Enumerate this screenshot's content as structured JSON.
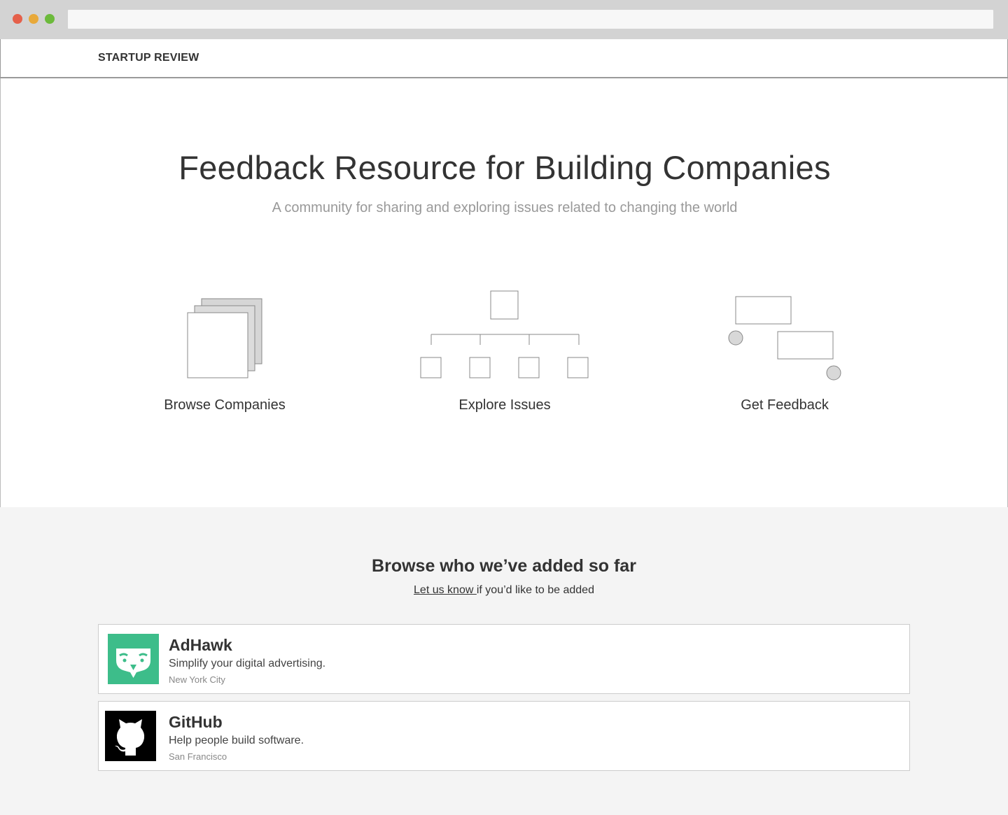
{
  "site": {
    "brand": "STARTUP REVIEW"
  },
  "hero": {
    "title": "Feedback Resource for Building Companies",
    "subtitle": "A community for sharing and exploring issues related to changing the world"
  },
  "features": [
    {
      "label": "Browse Companies",
      "icon": "stacked-pages-icon"
    },
    {
      "label": "Explore Issues",
      "icon": "hierarchy-tree-icon"
    },
    {
      "label": "Get Feedback",
      "icon": "comment-threads-icon"
    }
  ],
  "browse": {
    "title": "Browse who we’ve added so far",
    "link_text": "Let us know ",
    "suffix": "if you’d like to be added"
  },
  "companies": [
    {
      "name": "AdHawk",
      "description": "Simplify your digital advertising.",
      "location": "New York City",
      "logo": "owl-logo",
      "logo_color": "#3dbd8a"
    },
    {
      "name": "GitHub",
      "description": "Help people build software.",
      "location": "San Francisco",
      "logo": "octocat-logo",
      "logo_color": "#000000"
    }
  ]
}
